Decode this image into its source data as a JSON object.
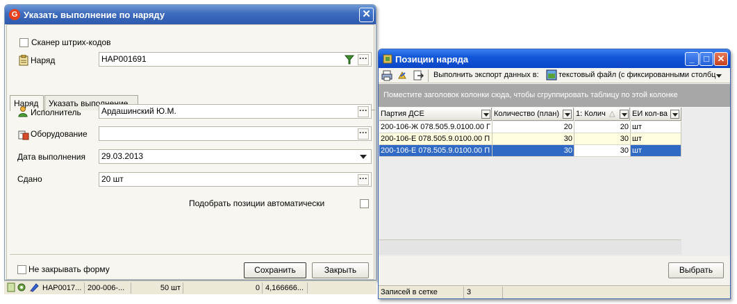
{
  "dialog": {
    "title": "Указать выполнение по наряду",
    "scanner_label": "Сканер штрих-кодов",
    "order_label": "Наряд",
    "order_value": "НАР001691",
    "tabs": [
      {
        "label": "Наряд",
        "active": true
      },
      {
        "label": "Указать выполнение",
        "active": false
      }
    ],
    "performer_label": "Исполнитель",
    "performer_value": "Ардашинский Ю.М.",
    "equipment_label": "Оборудование",
    "equipment_value": "",
    "date_label": "Дата выполнения",
    "date_value": "29.03.2013",
    "delivered_label": "Сдано",
    "delivered_value": "20 шт",
    "auto_select_label": "Подобрать позиции автоматически",
    "keep_open_label": "Не закрывать форму",
    "save_label": "Сохранить",
    "close_label": "Закрыть"
  },
  "strip": {
    "cells": [
      "НАР0017...",
      "200-006-...",
      "50 шт",
      "0",
      "4,166666..."
    ]
  },
  "positions": {
    "title": "Позиции наряда",
    "export_label": "Выполнить экспорт данных в:",
    "export_value": "текстовый файл (с фиксированными столбц",
    "group_hint": "Поместите заголовок колонки сюда, чтобы сгруппировать таблицу по этой колонке",
    "columns": [
      "Партия ДСЕ",
      "Количество (план)",
      "1: Колич",
      "ЕИ кол-ва"
    ],
    "rows": [
      {
        "batch": "200-106-Ж 078.505.9.0100.00 Г",
        "plan": "20",
        "qty": "20",
        "unit": "шт"
      },
      {
        "batch": "200-106-Е 078.505.9.0100.00 П",
        "plan": "30",
        "qty": "30",
        "unit": "шт"
      },
      {
        "batch": "200-106-Е 078.505.9.0100.00 П",
        "plan": "30",
        "qty": "30",
        "unit": "шт"
      }
    ],
    "choose_label": "Выбрать",
    "records_label": "Записей в сетке",
    "records_count": "3"
  },
  "colors": {
    "selected_row": "#316ac5",
    "highlight_row": "#fffde0"
  }
}
